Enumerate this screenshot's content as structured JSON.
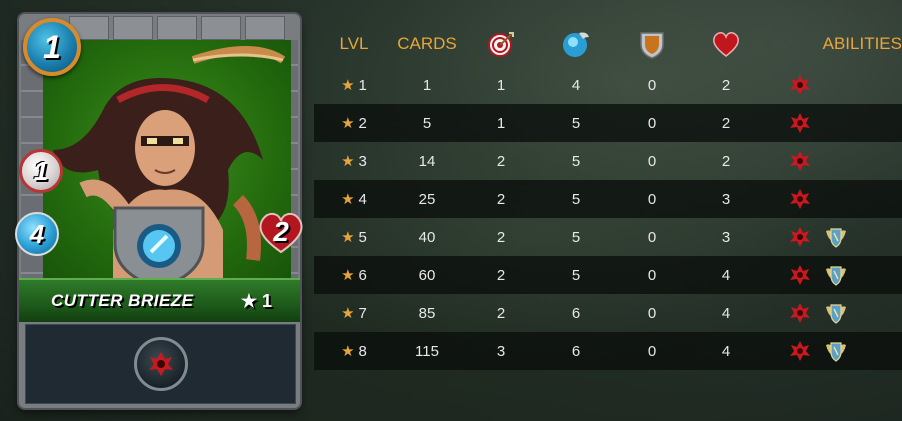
{
  "card": {
    "name": "CUTTER BRIEZE",
    "level_label": "★ 1",
    "mana": "1",
    "ranged": "1",
    "speed": "4",
    "health": "2",
    "ability_icon": "enrage-icon",
    "art_background": "#236a0d",
    "banner_color": "#1d5a1a"
  },
  "table": {
    "headers": {
      "lvl": "LVL",
      "cards": "CARDS",
      "ranged_icon": "ranged-attack-icon",
      "speed_icon": "speed-icon",
      "armor_icon": "armor-icon",
      "health_icon": "health-icon",
      "abilities": "ABILITIES"
    },
    "rows": [
      {
        "lvl": "1",
        "cards": "1",
        "ranged": "1",
        "speed": "4",
        "armor": "0",
        "health": "2",
        "abilities": [
          "enrage-icon"
        ]
      },
      {
        "lvl": "2",
        "cards": "5",
        "ranged": "1",
        "speed": "5",
        "armor": "0",
        "health": "2",
        "abilities": [
          "enrage-icon"
        ]
      },
      {
        "lvl": "3",
        "cards": "14",
        "ranged": "2",
        "speed": "5",
        "armor": "0",
        "health": "2",
        "abilities": [
          "enrage-icon"
        ]
      },
      {
        "lvl": "4",
        "cards": "25",
        "ranged": "2",
        "speed": "5",
        "armor": "0",
        "health": "3",
        "abilities": [
          "enrage-icon"
        ]
      },
      {
        "lvl": "5",
        "cards": "40",
        "ranged": "2",
        "speed": "5",
        "armor": "0",
        "health": "3",
        "abilities": [
          "enrage-icon",
          "shield-wings-icon"
        ]
      },
      {
        "lvl": "6",
        "cards": "60",
        "ranged": "2",
        "speed": "5",
        "armor": "0",
        "health": "4",
        "abilities": [
          "enrage-icon",
          "shield-wings-icon"
        ]
      },
      {
        "lvl": "7",
        "cards": "85",
        "ranged": "2",
        "speed": "6",
        "armor": "0",
        "health": "4",
        "abilities": [
          "enrage-icon",
          "shield-wings-icon"
        ]
      },
      {
        "lvl": "8",
        "cards": "115",
        "ranged": "3",
        "speed": "6",
        "armor": "0",
        "health": "4",
        "abilities": [
          "enrage-icon",
          "shield-wings-icon"
        ]
      }
    ]
  },
  "colors": {
    "accent": "#e8a53a",
    "row_dark": "#0a0e0c"
  }
}
